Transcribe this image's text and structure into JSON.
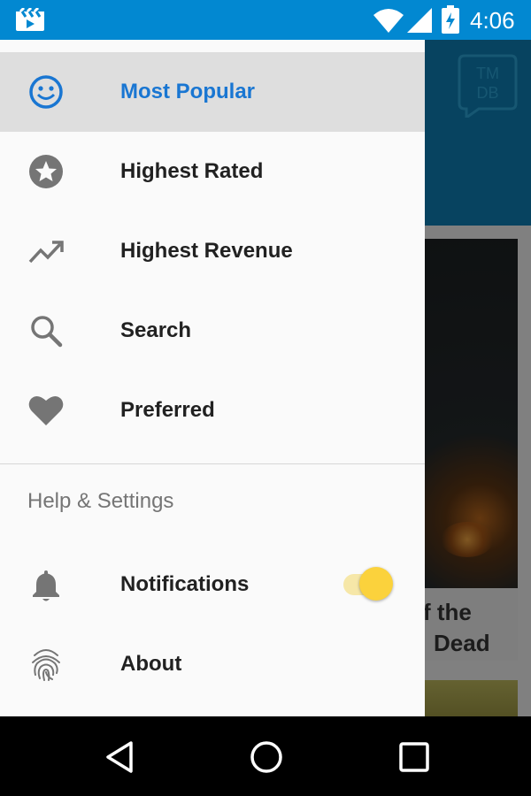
{
  "status_bar": {
    "time": "4:06",
    "icons": [
      "clapperboard-icon",
      "wifi-icon",
      "signal-icon",
      "battery-charging-icon"
    ]
  },
  "background_app": {
    "logo": {
      "line1": "TM",
      "line2": "DB"
    },
    "card_title_line1": "f the",
    "card_title_line2": "Dead"
  },
  "drawer": {
    "items": [
      {
        "label": "Most Popular",
        "icon": "smiley-icon",
        "active": true
      },
      {
        "label": "Highest Rated",
        "icon": "star-icon",
        "active": false
      },
      {
        "label": "Highest Revenue",
        "icon": "trending-up-icon",
        "active": false
      },
      {
        "label": "Search",
        "icon": "search-icon",
        "active": false
      },
      {
        "label": "Preferred",
        "icon": "heart-icon",
        "active": false
      }
    ],
    "section_header": "Help & Settings",
    "settings_items": [
      {
        "label": "Notifications",
        "icon": "bell-icon",
        "toggle_on": true
      },
      {
        "label": "About",
        "icon": "fingerprint-icon"
      }
    ]
  },
  "colors": {
    "status_bar": "#0288d1",
    "accent_active": "#1976d2",
    "toggle_thumb": "#fbd23c"
  },
  "nav_bar": {
    "buttons": [
      "back-icon",
      "home-icon",
      "recents-icon"
    ]
  }
}
